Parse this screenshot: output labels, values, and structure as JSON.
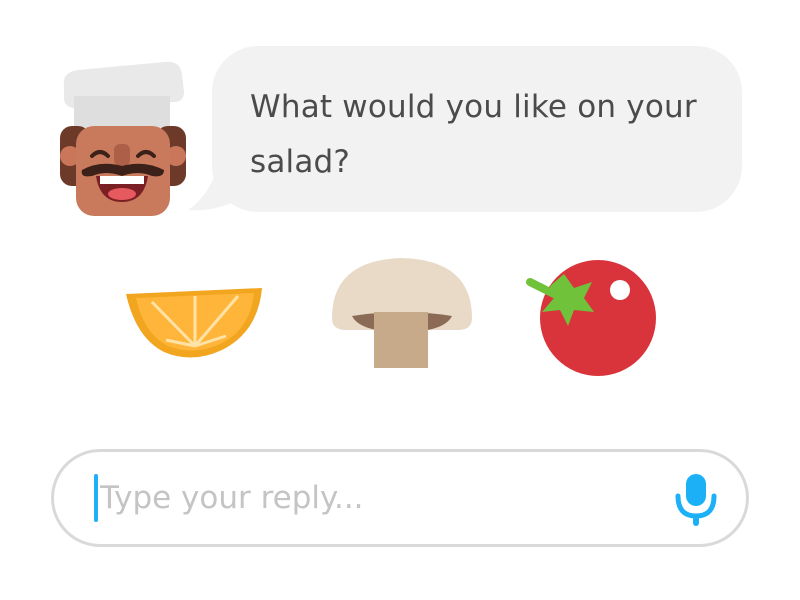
{
  "chat": {
    "speaker_icon": "chef-avatar-icon",
    "message": "What would you like on your salad?"
  },
  "options": [
    {
      "name": "orange",
      "icon": "orange-slice-icon"
    },
    {
      "name": "mushroom",
      "icon": "mushroom-icon"
    },
    {
      "name": "tomato",
      "icon": "tomato-icon"
    }
  ],
  "reply": {
    "placeholder": "Type your reply...",
    "value": "",
    "mic_icon": "microphone-icon"
  },
  "colors": {
    "bubble_bg": "#f2f2f2",
    "text": "#4b4b4b",
    "placeholder": "#c4c4c4",
    "accent_blue": "#1cb0f6",
    "input_border": "#d9d9d9"
  }
}
